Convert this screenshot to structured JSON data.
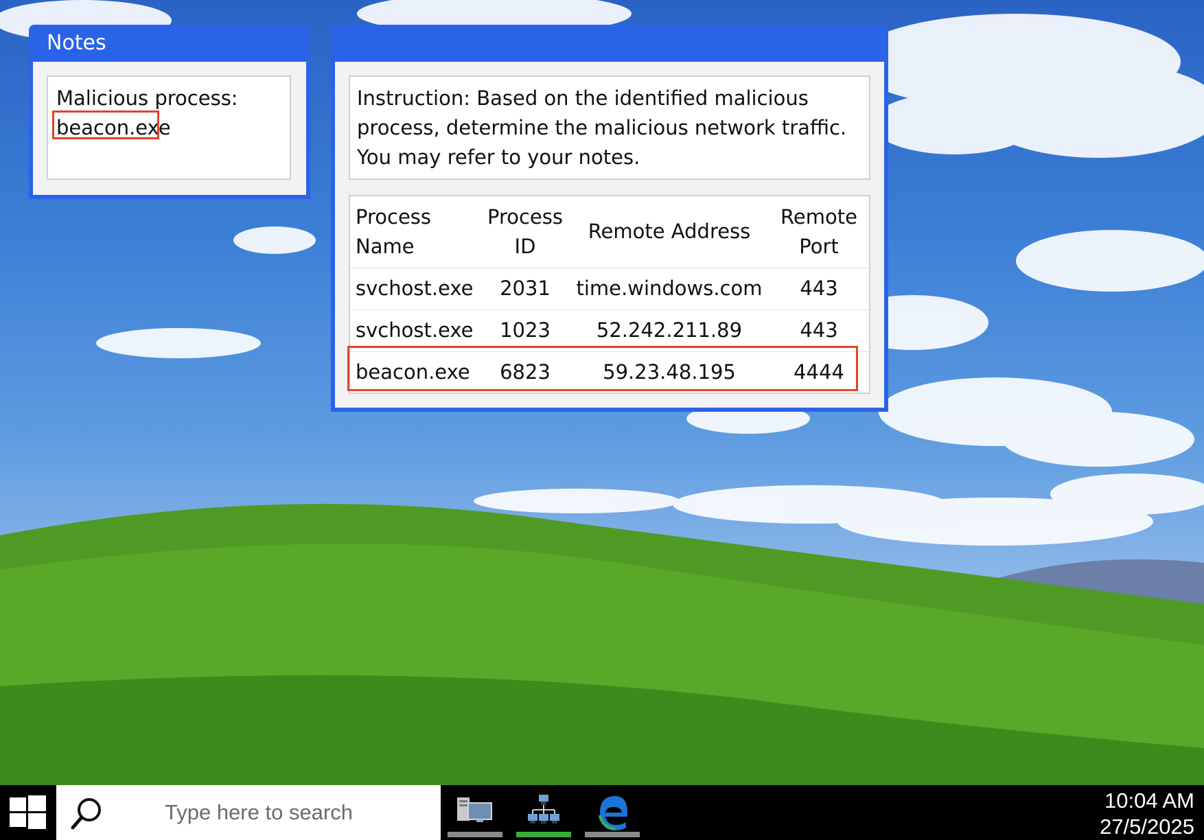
{
  "notes_window": {
    "title": "Notes",
    "label": "Malicious process:",
    "value": "beacon.exe"
  },
  "main_window": {
    "title": "",
    "instruction": "Instruction: Based on the identified malicious process, determine the malicious network traffic. You may refer to your notes.",
    "table": {
      "headers": {
        "name_line1": "Process",
        "name_line2": "Name",
        "pid_line1": "Process",
        "pid_line2": "ID",
        "address": "Remote Address",
        "port_line1": "Remote",
        "port_line2": "Port"
      },
      "rows": [
        {
          "name": "svchost.exe",
          "pid": "2031",
          "address": "time.windows.com",
          "port": "443"
        },
        {
          "name": "svchost.exe",
          "pid": "1023",
          "address": "52.242.211.89",
          "port": "443"
        },
        {
          "name": "beacon.exe",
          "pid": "6823",
          "address": "59.23.48.195",
          "port": "4444"
        }
      ],
      "highlighted_row": 2
    }
  },
  "taskbar": {
    "start_icon": "windows-logo-icon",
    "search_placeholder": "Type here to search",
    "apps": [
      {
        "icon": "task-manager-icon",
        "active": false
      },
      {
        "icon": "network-icon",
        "active": true
      },
      {
        "icon": "edge-browser-icon",
        "active": false
      }
    ],
    "time": "10:04 AM",
    "date": "27/5/2025"
  },
  "colors": {
    "window_blue": "#2b63e8",
    "highlight_red": "#e0432c",
    "active_app_bar": "#3aae3a",
    "inactive_app_bar": "#8a8a8a"
  }
}
